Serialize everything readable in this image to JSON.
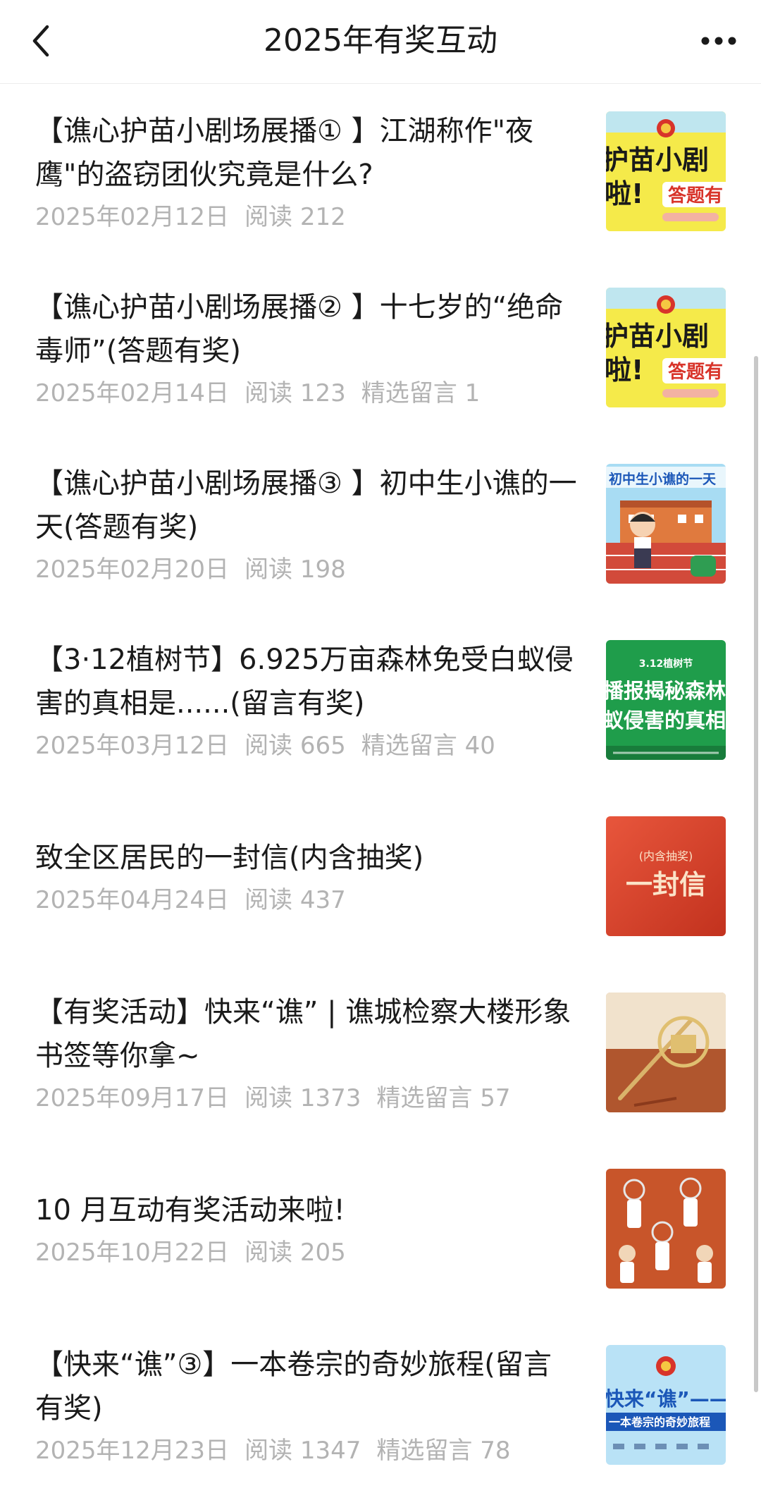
{
  "nav": {
    "title": "2025年有奖互动",
    "back_icon": "chevron-left-icon",
    "more_icon": "more-horizontal-icon"
  },
  "articles": [
    {
      "title": "【谯心护苗小剧场展播① 】江湖称作\"夜鹰\"的盗窃团伙究竟是什么?",
      "date": "2025年02月12日",
      "reads": "阅读 212",
      "comments": "",
      "thumb_text_a": "护苗小剧",
      "thumb_text_b": "啦!",
      "thumb_text_c": "答题有"
    },
    {
      "title": "【谯心护苗小剧场展播② 】十七岁的“绝命毒师”(答题有奖)",
      "date": "2025年02月14日",
      "reads": "阅读 123",
      "comments": "精选留言 1",
      "thumb_text_a": "护苗小剧",
      "thumb_text_b": "啦!",
      "thumb_text_c": "答题有"
    },
    {
      "title": "【谯心护苗小剧场展播③ 】初中生小谯的一天(答题有奖)",
      "date": "2025年02月20日",
      "reads": "阅读 198",
      "comments": "",
      "thumb_text_a": "初中生小谯的一天"
    },
    {
      "title": "【3·12植树节】6.925万亩森林免受白蚁侵害的真相是......(留言有奖)",
      "date": "2025年03月12日",
      "reads": "阅读 665",
      "comments": "精选留言 40",
      "thumb_text_a": "3.12植树节",
      "thumb_text_b": "播报揭秘森林",
      "thumb_text_c": "蚁侵害的真相"
    },
    {
      "title": "致全区居民的一封信(内含抽奖)",
      "date": "2025年04月24日",
      "reads": "阅读 437",
      "comments": "",
      "thumb_text_a": "(内含抽奖)",
      "thumb_text_b": "一封信"
    },
    {
      "title": "【有奖活动】快来“谯” | 谯城检察大楼形象书签等你拿~",
      "date": "2025年09月17日",
      "reads": "阅读 1373",
      "comments": "精选留言 57"
    },
    {
      "title": "10 月互动有奖活动来啦!",
      "date": "2025年10月22日",
      "reads": "阅读 205",
      "comments": ""
    },
    {
      "title": "【快来“谯”③】一本卷宗的奇妙旅程(留言有奖)",
      "date": "2025年12月23日",
      "reads": "阅读 1347",
      "comments": "精选留言 78",
      "thumb_text_a": "快来“谯”——",
      "thumb_text_b": "一本卷宗的奇妙旅程"
    }
  ],
  "colors": {
    "title_text": "#1a1a1a",
    "meta_text": "#b3b3b3",
    "thumb_yellow": "#f7e84a",
    "thumb_green": "#1f9d4b",
    "thumb_red": "#d5412a",
    "thumb_orange": "#c8552a",
    "thumb_blue": "#9fd3f0"
  }
}
